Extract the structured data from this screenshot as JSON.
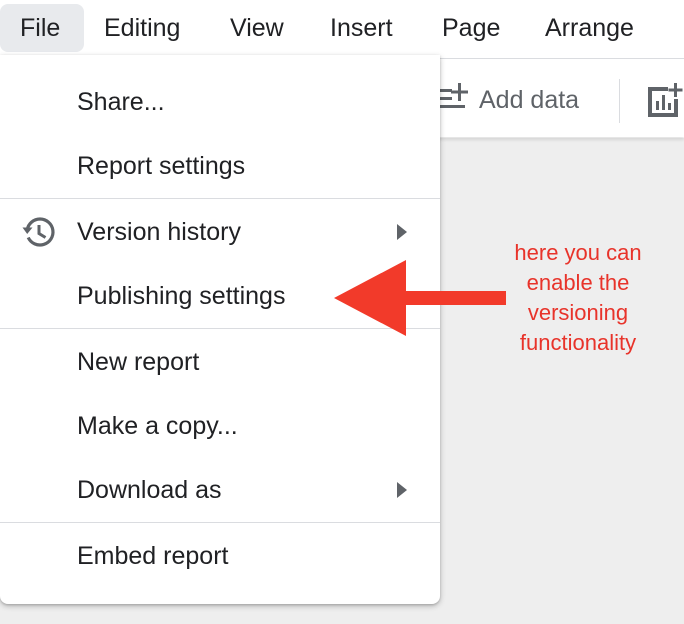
{
  "menubar": {
    "items": [
      {
        "label": "File",
        "active": true
      },
      {
        "label": "Editing"
      },
      {
        "label": "View"
      },
      {
        "label": "Insert"
      },
      {
        "label": "Page"
      },
      {
        "label": "Arrange"
      }
    ]
  },
  "toolbar": {
    "add_data_label": "Add data",
    "add_data_icon": "add-data-icon",
    "add_chart_icon": "add-chart-icon"
  },
  "file_menu": {
    "items": [
      {
        "label": "Share..."
      },
      {
        "label": "Report settings"
      },
      {
        "label": "Version history",
        "icon": "history-icon",
        "has_submenu": true
      },
      {
        "label": "Publishing settings"
      },
      {
        "label": "New report"
      },
      {
        "label": "Make a copy..."
      },
      {
        "label": "Download as",
        "has_submenu": true
      },
      {
        "label": "Embed report"
      }
    ]
  },
  "annotation": {
    "lines": [
      "here you can",
      "enable the",
      "versioning",
      "functionality"
    ],
    "color": "#e8332a"
  },
  "colors": {
    "active_menu_bg": "#e8eaed",
    "canvas_bg": "#eeeeee",
    "divider": "#dadce0"
  }
}
